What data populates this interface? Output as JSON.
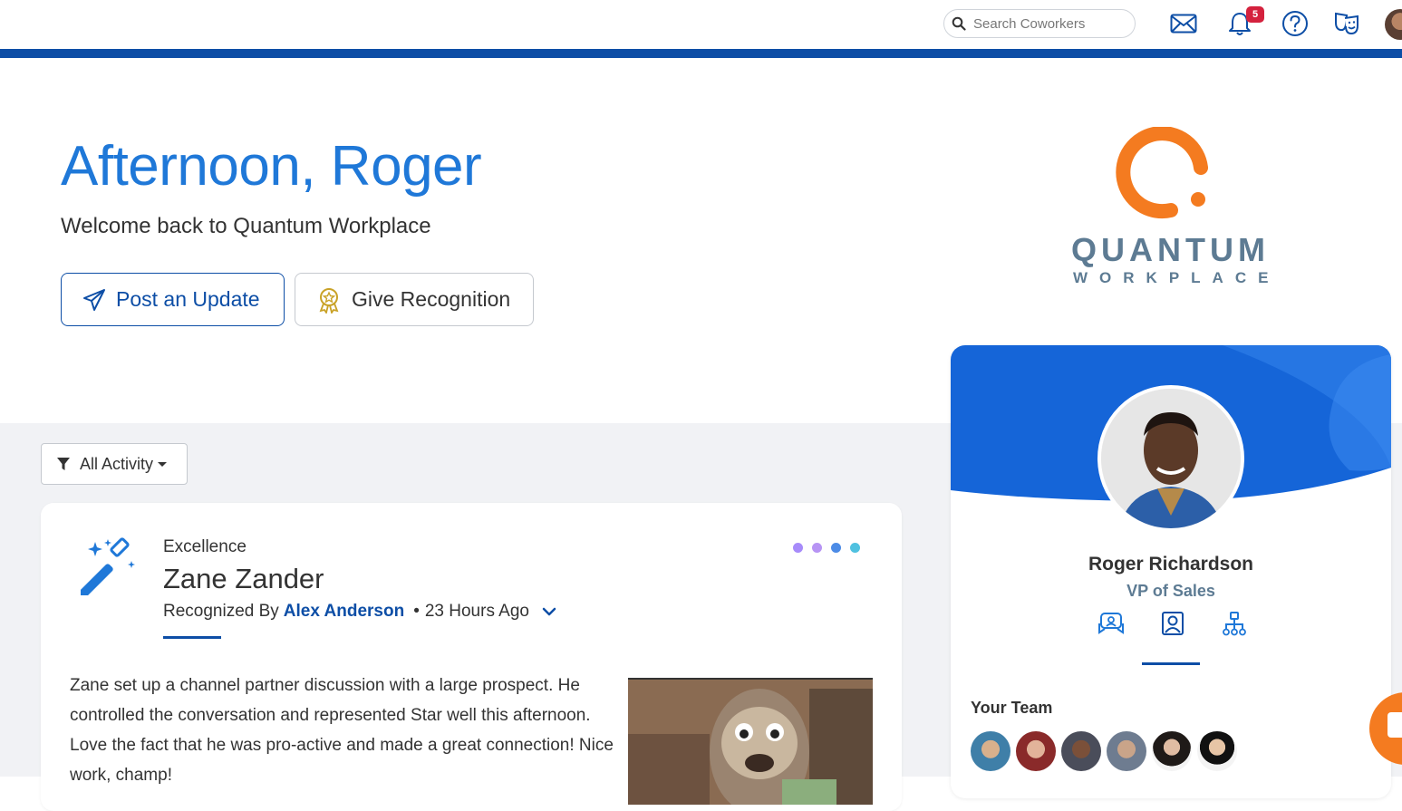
{
  "header": {
    "search_placeholder": "Search Coworkers",
    "notification_count": "5"
  },
  "hero": {
    "greeting": "Afternoon, Roger",
    "subtitle": "Welcome back to Quantum Workplace",
    "post_update_label": "Post an Update",
    "give_recognition_label": "Give Recognition"
  },
  "logo": {
    "line1": "QUANTUM",
    "line2": "WORKPLACE"
  },
  "feed": {
    "filter_label": "All Activity",
    "post": {
      "category": "Excellence",
      "recipient": "Zane Zander",
      "recognized_by_label": "Recognized By",
      "author": "Alex Anderson",
      "time": "23 Hours Ago",
      "body": "Zane set up a channel partner discussion with a large prospect. He controlled the conversation and represented Star well this afternoon. Love the fact that he was pro-active and made a great connection! Nice work, champ!"
    }
  },
  "profile": {
    "name": "Roger Richardson",
    "title": "VP of Sales",
    "team_label": "Your Team"
  },
  "colors": {
    "brand_blue": "#0d4ea6",
    "greeting_blue": "#1f78d8",
    "logo_orange": "#f47b20",
    "badge_red": "#d4213d"
  }
}
